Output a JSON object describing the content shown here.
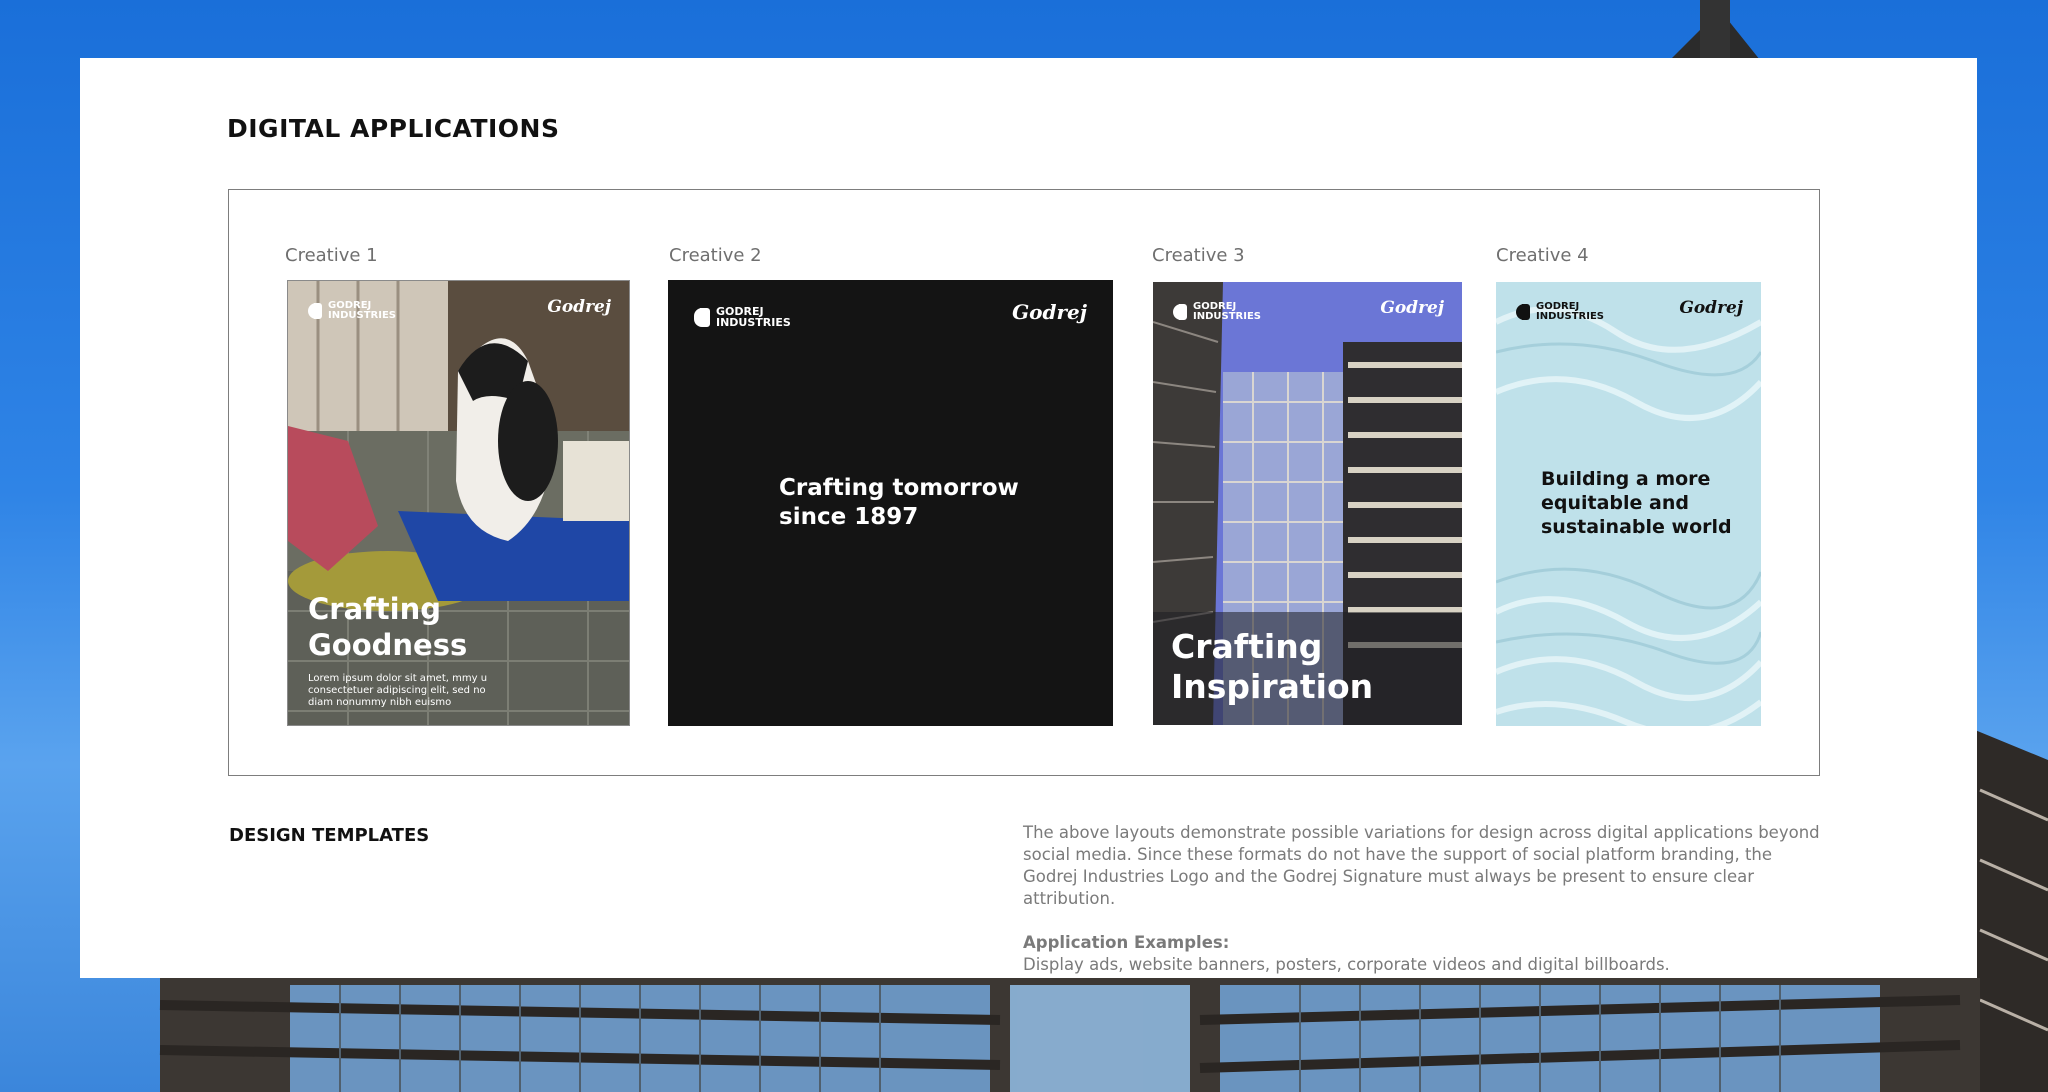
{
  "page": {
    "heading": "DIGITAL APPLICATIONS",
    "subheading": "DESIGN TEMPLATES",
    "description": "The above layouts demonstrate possible variations for design across digital applications beyond social media. Since these formats do not have the support of social platform branding, the Godrej Industries Logo and the Godrej Signature must always be present to ensure clear attribution.",
    "examples_title": "Application Examples:",
    "examples_text": "Display ads, website banners, posters, corporate videos and digital billboards."
  },
  "brand": {
    "logo_line1": "GODREJ",
    "logo_line2": "INDUSTRIES",
    "signature": "Godrej"
  },
  "creatives": [
    {
      "caption": "Creative 1",
      "headline": "Crafting\nGoodness",
      "body": "Lorem ipsum dolor sit amet, mmy u\nconsectetuer adipiscing elit, sed no\ndiam nonummy nibh euismo"
    },
    {
      "caption": "Creative 2",
      "headline": "Crafting tomorrow\nsince 1897"
    },
    {
      "caption": "Creative 3",
      "headline": "Crafting\nInspiration"
    },
    {
      "caption": "Creative 4",
      "headline": "Building a more\nequitable and\nsustainable world"
    }
  ],
  "colors": {
    "sky": "#2f84e6",
    "panel": "#ffffff",
    "creative2_bg": "#141414",
    "creative4_bg": "#bfe1ea"
  }
}
